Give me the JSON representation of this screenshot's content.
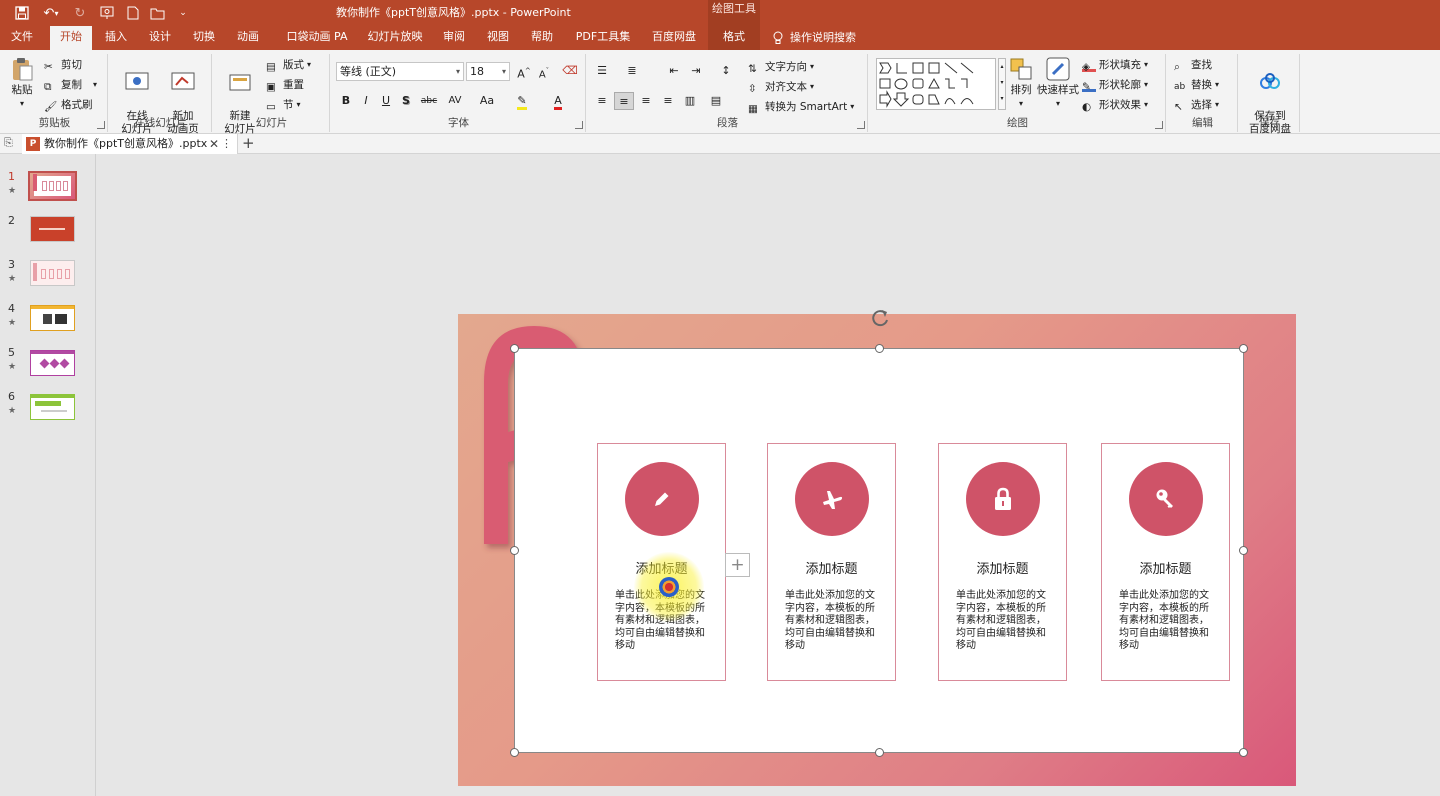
{
  "titlebar": {
    "doc_title": "教你制作《pptT创意风格》.pptx  -  PowerPoint",
    "drawing_tools": "绘图工具"
  },
  "tabs": [
    "文件",
    "开始",
    "插入",
    "设计",
    "切换",
    "动画",
    "口袋动画 PA",
    "幻灯片放映",
    "审阅",
    "视图",
    "帮助",
    "PDF工具集",
    "百度网盘",
    "格式"
  ],
  "search_label": "操作说明搜索",
  "ribbon": {
    "clipboard": {
      "paste": "粘贴",
      "cut": "剪切",
      "copy": "复制",
      "format_painter": "格式刷",
      "label": "剪贴板"
    },
    "online_slides": {
      "online": "在线\n幻灯片",
      "new_anim": "新加\n动画页",
      "label": "在线幻灯片"
    },
    "slides": {
      "new_slide": "新建\n幻灯片",
      "layout": "版式",
      "reset": "重置",
      "section": "节",
      "label": "幻灯片"
    },
    "font": {
      "font_name": "等线 (正文)",
      "font_size": "18",
      "bold": "B",
      "italic": "I",
      "underline": "U",
      "shadow": "S",
      "strike": "abc",
      "spacing": "AV",
      "case": "Aa",
      "label": "字体"
    },
    "paragraph": {
      "text_direction": "文字方向",
      "align_text": "对齐文本",
      "smartart": "转换为 SmartArt",
      "label": "段落"
    },
    "drawing": {
      "arrange": "排列",
      "quick_styles": "快速样式",
      "shape_fill": "形状填充",
      "shape_outline": "形状轮廓",
      "shape_effects": "形状效果",
      "label": "绘图"
    },
    "editing": {
      "find": "查找",
      "replace": "替换",
      "select": "选择",
      "label": "编辑"
    },
    "save": {
      "save_to_baidu": "保存到\n百度网盘",
      "label": "保存"
    }
  },
  "doc_tab": {
    "name": "教你制作《pptT创意风格》.pptx"
  },
  "thumbnails": [
    {
      "num": "1",
      "star": "★"
    },
    {
      "num": "2",
      "star": ""
    },
    {
      "num": "3",
      "star": "★"
    },
    {
      "num": "4",
      "star": "★"
    },
    {
      "num": "5",
      "star": "★"
    },
    {
      "num": "6",
      "star": "★"
    }
  ],
  "slide": {
    "cards": [
      {
        "title": "添加标题",
        "body": "单击此处添加您的文字内容，本模板的所有素材和逻辑图表，均可自由编辑替换和移动",
        "icon": "pencil-icon"
      },
      {
        "title": "添加标题",
        "body": "单击此处添加您的文字内容，本模板的所有素材和逻辑图表，均可自由编辑替换和移动",
        "icon": "airplane-icon"
      },
      {
        "title": "添加标题",
        "body": "单击此处添加您的文字内容，本模板的所有素材和逻辑图表，均可自由编辑替换和移动",
        "icon": "lock-icon"
      },
      {
        "title": "添加标题",
        "body": "单击此处添加您的文字内容，本模板的所有素材和逻辑图表，均可自由编辑替换和移动",
        "icon": "key-icon"
      }
    ]
  },
  "colors": {
    "accent": "#b7472a",
    "card_circle": "#cf5368",
    "card_border": "#d98a99",
    "letter": "#d95c72"
  }
}
